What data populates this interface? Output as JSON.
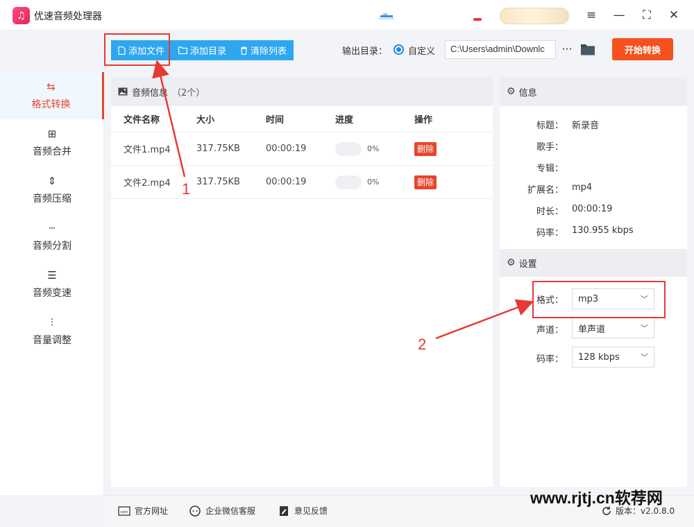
{
  "app": {
    "title": "优速音频处理器",
    "logo_text": "♫"
  },
  "window_controls": {
    "menu": "≡",
    "minimize": "—",
    "maximize": "⛶",
    "close": "✕"
  },
  "toolbar": {
    "add_file": "添加文件",
    "add_folder": "添加目录",
    "clear_list": "清除列表",
    "output_label": "输出目录：",
    "custom_label": "自定义",
    "output_path": "C:\\Users\\admin\\Downlc",
    "more": "···",
    "start": "开始转换"
  },
  "sidebar": {
    "items": [
      {
        "label": "格式转换",
        "icon": "⇆",
        "active": true
      },
      {
        "label": "音频合并",
        "icon": "⊞"
      },
      {
        "label": "音频压缩",
        "icon": "⇕"
      },
      {
        "label": "音频分割",
        "icon": "┄"
      },
      {
        "label": "音频变速",
        "icon": "☰"
      },
      {
        "label": "音量调整",
        "icon": "⫶"
      }
    ]
  },
  "file_list": {
    "header": "音频信息",
    "count": "（2个）",
    "columns": [
      "文件名称",
      "大小",
      "时间",
      "进度",
      "操作"
    ],
    "rows": [
      {
        "name": "文件1.mp4",
        "size": "317.75KB",
        "time": "00:00:19",
        "progress": "0%",
        "action": "删除"
      },
      {
        "name": "文件2.mp4",
        "size": "317.75KB",
        "time": "00:00:19",
        "progress": "0%",
        "action": "删除"
      }
    ]
  },
  "info": {
    "header": "信息",
    "rows": [
      {
        "key": "标题：",
        "value": "新录音"
      },
      {
        "key": "歌手：",
        "value": ""
      },
      {
        "key": "专辑：",
        "value": ""
      },
      {
        "key": "扩展名：",
        "value": "mp4"
      },
      {
        "key": "时长：",
        "value": "00:00:19"
      },
      {
        "key": "码率：",
        "value": "130.955 kbps"
      }
    ]
  },
  "settings": {
    "header": "设置",
    "format": {
      "label": "格式：",
      "value": "mp3"
    },
    "channel": {
      "label": "声道：",
      "value": "单声道"
    },
    "bitrate": {
      "label": "码率：",
      "value": "128 kbps"
    }
  },
  "annotations": {
    "one": "1",
    "two": "2",
    "color": "#e53935"
  },
  "footer": {
    "website": "官方网址",
    "wechat": "企业微信客服",
    "feedback": "意见反馈",
    "version": "版本：v2.0.8.0"
  },
  "watermark": "www.rjtj.cn软荐网",
  "colors": {
    "accent_blue": "#2ea7f0",
    "accent_orange": "#f4511e",
    "active_red": "#e8452d"
  }
}
